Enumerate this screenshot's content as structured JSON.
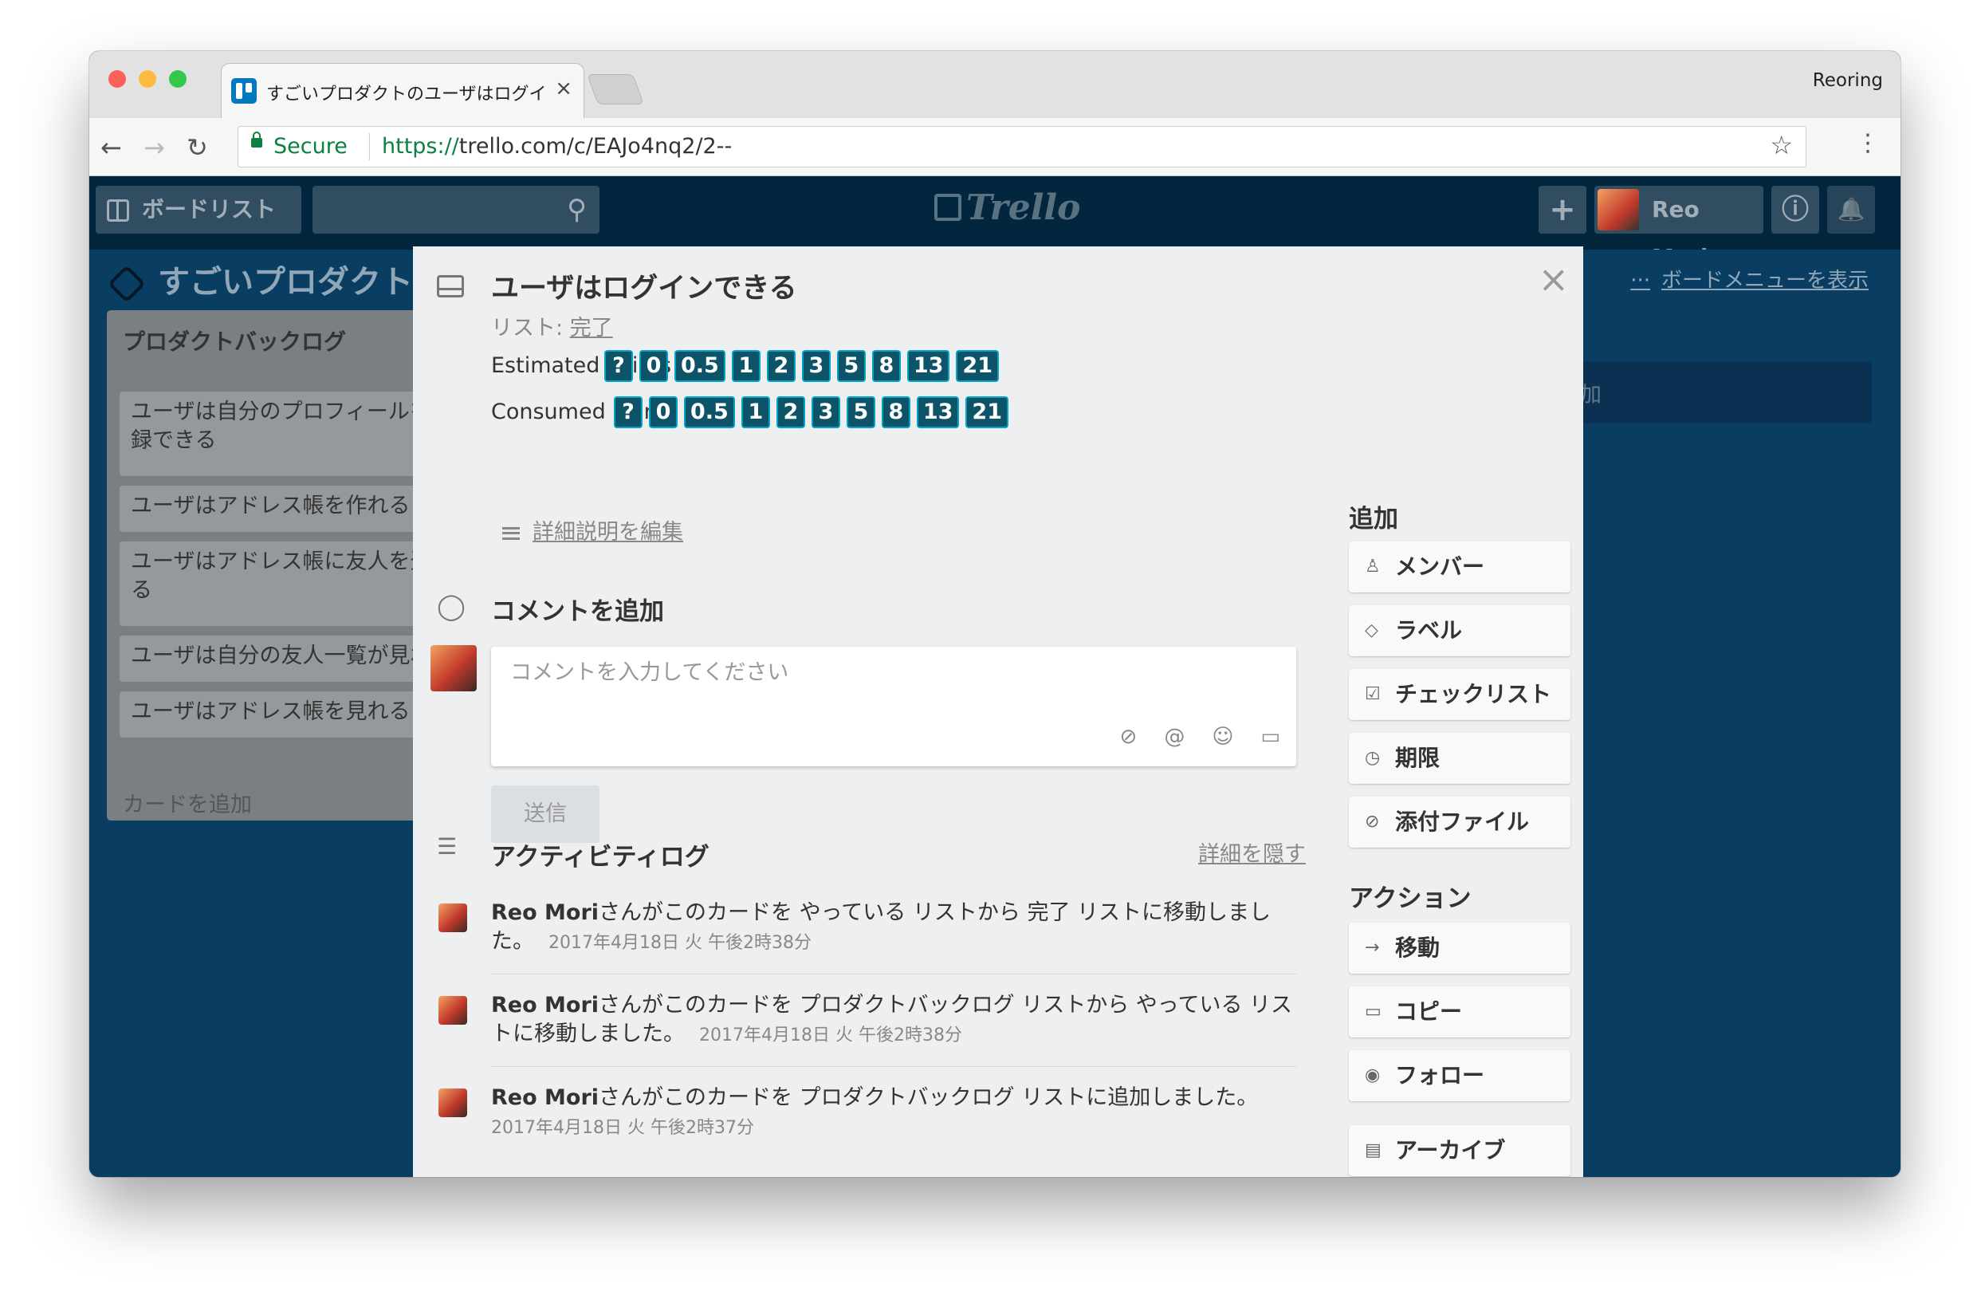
{
  "browser": {
    "tab_title": "すごいプロダクトのユーザはログインできる",
    "tab_close": "×",
    "profile_name": "Reoring",
    "nav_back": "←",
    "nav_forward": "→",
    "nav_reload": "↻",
    "secure_label": "Secure",
    "url_protocol": "https://",
    "url_rest": "trello.com/c/EAJo4nq2/2--",
    "bookmark": "☆",
    "menu": "⋮"
  },
  "header": {
    "boards_label": "ボードリスト",
    "search_icon": "⚲",
    "logo": "Trello",
    "add": "+",
    "user_name": "Reo Mori",
    "info": "ⓘ",
    "bell": "🔔"
  },
  "board": {
    "title": "すごいプロダクト",
    "menu_dots": "···",
    "menu_link": "ボードメニューを表示",
    "list_title": "プロダクトバックログ",
    "cards": [
      "ユーザは自分のプロフィールを登",
      "録できる",
      "ユーザはアドレス帳を作れる",
      "ユーザはアドレス帳に友人を登録でき",
      "る",
      "ユーザは自分の友人一覧が見れる",
      "ユーザはアドレス帳を見れる"
    ],
    "add_card": "カードを追加",
    "list2_text": "加"
  },
  "modal": {
    "close": "×",
    "title": "ユーザはログインできる",
    "list_prefix": "リスト: ",
    "list_name": "完了",
    "estimated_label": "Estimated Points",
    "consumed_label": "Consumed Points",
    "points": [
      "?",
      "0",
      "0.5",
      "1",
      "2",
      "3",
      "5",
      "8",
      "13",
      "21"
    ],
    "edit_description": "詳細説明を編集",
    "add_comment_heading": "コメントを追加",
    "comment_placeholder": "コメントを入力してください",
    "tool_attach": "⊘",
    "tool_mention": "@",
    "tool_emoji": "☺",
    "tool_card": "▭",
    "send": "送信",
    "activity_heading": "アクティビティログ",
    "hide_details": "詳細を隠す",
    "activities": [
      {
        "user": "Reo Mori",
        "text": "さんがこのカードを やっている リストから 完了 リストに移動しました。",
        "time": "2017年4月18日 火 午後2時38分"
      },
      {
        "user": "Reo Mori",
        "text": "さんがこのカードを プロダクトバックログ リストから やっている リストに移動しました。",
        "time": "2017年4月18日 火 午後2時38分"
      },
      {
        "user": "Reo Mori",
        "text": "さんがこのカードを プロダクトバックログ リストに追加しました。",
        "time": "2017年4月18日 火 午後2時37分"
      }
    ],
    "add_heading": "追加",
    "add_buttons": [
      {
        "icon": "♙",
        "label": "メンバー"
      },
      {
        "icon": "◇",
        "label": "ラベル"
      },
      {
        "icon": "☑",
        "label": "チェックリスト"
      },
      {
        "icon": "◷",
        "label": "期限"
      },
      {
        "icon": "⊘",
        "label": "添付ファイル"
      }
    ],
    "actions_heading": "アクション",
    "action_buttons": [
      {
        "icon": "→",
        "label": "移動"
      },
      {
        "icon": "▭",
        "label": "コピー"
      },
      {
        "icon": "◉",
        "label": "フォロー"
      },
      {
        "icon": "▤",
        "label": "アーカイブ"
      }
    ]
  },
  "colors": {
    "board_bg": "#0a3d62",
    "header_bg": "#03263f",
    "point_bg": "#0d5469",
    "point_border": "#00a5c8",
    "secure_green": "#0b8043"
  }
}
